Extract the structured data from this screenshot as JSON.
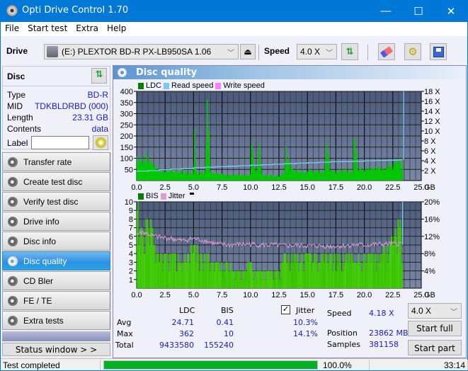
{
  "window": {
    "title": "Opti Drive Control 1.70",
    "controls": {
      "minimize": "—",
      "maximize": "☐",
      "close": "✕"
    }
  },
  "menu": {
    "items": [
      "File",
      "Start test",
      "Extra",
      "Help"
    ]
  },
  "toolbar": {
    "drive_label": "Drive",
    "drive_value": "(E:)  PLEXTOR BD-R  PX-LB950SA 1.06",
    "speed_label": "Speed",
    "speed_value": "4.0 X",
    "icons": [
      "drive-icon",
      "eject-icon",
      "refresh-icon",
      "eraser-icon",
      "settings-icon",
      "save-icon"
    ]
  },
  "disc": {
    "header": "Disc",
    "rows": [
      {
        "key": "Type",
        "value": "BD-R"
      },
      {
        "key": "MID",
        "value": "TDKBLDRBD (000)"
      },
      {
        "key": "Length",
        "value": "23.31 GB"
      },
      {
        "key": "Contents",
        "value": "data"
      }
    ],
    "label_key": "Label",
    "label_value": ""
  },
  "nav": {
    "items": [
      {
        "label": "Transfer rate",
        "active": false
      },
      {
        "label": "Create test disc",
        "active": false
      },
      {
        "label": "Verify test disc",
        "active": false
      },
      {
        "label": "Drive info",
        "active": false
      },
      {
        "label": "Disc info",
        "active": false
      },
      {
        "label": "Disc quality",
        "active": true
      },
      {
        "label": "CD Bler",
        "active": false
      },
      {
        "label": "FE / TE",
        "active": false
      },
      {
        "label": "Extra tests",
        "active": false
      }
    ],
    "status_window_button": "Status window > >"
  },
  "panel": {
    "title": "Disc quality"
  },
  "colors": {
    "ldc": "#00c800",
    "read_speed": "#78c8f0",
    "write_speed": "#ff80ff",
    "bis": "#40c800",
    "jitter": "#d8a0d0",
    "plot_bg_top": "#4a5a7a",
    "plot_bg_bottom": "#7a88a8",
    "active_nav": "#2e8fe0",
    "progress": "#06b025",
    "value_blue": "#1a1acc"
  },
  "chart_data": [
    {
      "type": "area",
      "title": "LDC / Read speed",
      "legend": [
        "LDC",
        "Read speed",
        "Write speed"
      ],
      "legend_placement": "top-left",
      "xlabel": "GB",
      "x_ticks": [
        "0.0",
        "2.5",
        "5.0",
        "7.5",
        "10.0",
        "12.5",
        "15.0",
        "17.5",
        "20.0",
        "22.5",
        "25.0"
      ],
      "xlim": [
        0,
        25
      ],
      "y_left_ticks": [
        "50",
        "100",
        "150",
        "200",
        "250",
        "300",
        "350",
        "400"
      ],
      "ylim_left": [
        0,
        400
      ],
      "y_right_ticks": [
        "2 X",
        "4 X",
        "6 X",
        "8 X",
        "10 X",
        "12 X",
        "14 X",
        "16 X",
        "18 X"
      ],
      "ylim_right": [
        0,
        18
      ],
      "grid": true,
      "series": [
        {
          "name": "LDC",
          "x": [
            0.0,
            0.3,
            0.6,
            0.9,
            1.2,
            1.5,
            1.8,
            2.0,
            2.5,
            3.0,
            3.5,
            4.0,
            4.5,
            5.0,
            5.1,
            5.3,
            5.6,
            6.0,
            6.2,
            6.5,
            7.0,
            7.5,
            8.0,
            9.0,
            10.0,
            10.1,
            10.5,
            10.8,
            11.0,
            12.0,
            12.4,
            12.5,
            13.0,
            13.1,
            13.5,
            14.0,
            15.0,
            15.5,
            16.0,
            16.5,
            16.7,
            17.0,
            17.5,
            18.0,
            18.5,
            19.0,
            19.1,
            19.5,
            20.0,
            20.5,
            21.0,
            21.3,
            21.5,
            22.0,
            22.5,
            22.8,
            23.0,
            23.3,
            23.4
          ],
          "values": [
            120,
            100,
            105,
            110,
            95,
            85,
            60,
            50,
            45,
            45,
            45,
            42,
            40,
            45,
            230,
            40,
            38,
            40,
            362,
            35,
            30,
            30,
            28,
            30,
            30,
            165,
            30,
            160,
            28,
            25,
            25,
            22,
            50,
            155,
            55,
            50,
            50,
            45,
            50,
            45,
            170,
            45,
            45,
            50,
            55,
            50,
            190,
            50,
            55,
            55,
            50,
            90,
            65,
            70,
            75,
            90,
            85,
            60,
            90
          ]
        },
        {
          "name": "Read speed",
          "unit": "X",
          "x": [
            0.0,
            1.0,
            2.0,
            3.0,
            4.0,
            5.0,
            6.0,
            7.0,
            8.0,
            9.0,
            10.0,
            11.0,
            12.0,
            13.0,
            14.0,
            15.0,
            16.0,
            17.0,
            18.0,
            19.0,
            20.0,
            21.0,
            22.0,
            23.0,
            23.3
          ],
          "values": [
            1.9,
            2.0,
            2.2,
            2.3,
            2.4,
            2.6,
            2.7,
            2.8,
            2.9,
            3.0,
            3.1,
            3.2,
            3.3,
            3.4,
            3.5,
            3.6,
            3.7,
            3.8,
            3.85,
            3.9,
            4.0,
            4.05,
            4.1,
            4.15,
            4.18
          ]
        },
        {
          "name": "Write speed",
          "unit": "X",
          "x": [],
          "values": []
        }
      ]
    },
    {
      "type": "area",
      "title": "BIS / Jitter",
      "legend": [
        "BIS",
        "Jitter"
      ],
      "legend_placement": "top-left",
      "xlabel": "GB",
      "x_ticks": [
        "0.0",
        "2.5",
        "5.0",
        "7.5",
        "10.0",
        "12.5",
        "15.0",
        "17.5",
        "20.0",
        "22.5",
        "25.0"
      ],
      "xlim": [
        0,
        25
      ],
      "y_left_ticks": [
        "1",
        "2",
        "3",
        "4",
        "5",
        "6",
        "7",
        "8",
        "9",
        "10"
      ],
      "ylim_left": [
        0,
        10
      ],
      "y_right_ticks": [
        "4%",
        "8%",
        "12%",
        "16%",
        "20%"
      ],
      "ylim_right": [
        0,
        20
      ],
      "grid": true,
      "series": [
        {
          "name": "BIS",
          "x": [
            0.0,
            0.2,
            0.5,
            1.0,
            1.3,
            1.6,
            2.0,
            3.0,
            4.0,
            5.0,
            5.5,
            6.0,
            6.5,
            7.0,
            7.5,
            8.0,
            9.0,
            10.0,
            11.0,
            12.0,
            12.5,
            13.0,
            14.0,
            15.0,
            16.0,
            17.0,
            18.0,
            19.0,
            20.0,
            21.0,
            22.0,
            22.5,
            23.0,
            23.3
          ],
          "values": [
            10,
            8,
            7,
            8,
            7,
            5,
            4,
            4,
            4,
            5,
            4,
            4,
            3,
            3,
            3,
            3,
            2,
            3,
            2,
            2,
            2,
            4,
            4,
            4,
            4,
            4,
            4,
            4,
            4,
            4,
            5,
            7,
            8,
            5
          ]
        },
        {
          "name": "Jitter",
          "unit": "%",
          "x": [
            0.0,
            0.5,
            1.0,
            1.5,
            2.0,
            3.0,
            4.0,
            5.0,
            6.0,
            7.0,
            8.0,
            9.0,
            10.0,
            11.0,
            12.0,
            13.0,
            14.0,
            15.0,
            16.0,
            17.0,
            18.0,
            19.0,
            20.0,
            21.0,
            22.0,
            23.0,
            23.3
          ],
          "values": [
            12.5,
            13.0,
            12.5,
            12.0,
            11.8,
            11.5,
            11.0,
            11.5,
            11.0,
            10.2,
            10.0,
            10.1,
            10.2,
            10.0,
            10.0,
            9.8,
            9.9,
            9.8,
            9.8,
            9.7,
            9.8,
            10.0,
            10.0,
            10.1,
            10.2,
            10.3,
            10.3
          ]
        }
      ]
    }
  ],
  "stats": {
    "col_headers": [
      "LDC",
      "BIS"
    ],
    "rows": [
      {
        "label": "Avg",
        "ldc": "24.71",
        "bis": "0.41",
        "jitter": "10.3%"
      },
      {
        "label": "Max",
        "ldc": "362",
        "bis": "10",
        "jitter": "14.1%"
      },
      {
        "label": "Total",
        "ldc": "9433580",
        "bis": "155240"
      }
    ],
    "jitter_label": "Jitter",
    "jitter_checked": true,
    "speed_label": "Speed",
    "speed_value": "4.18 X",
    "position_label": "Position",
    "position_value": "23862 MB",
    "samples_label": "Samples",
    "samples_value": "381158",
    "speed_select": "4.0 X",
    "start_full": "Start full",
    "start_part": "Start part"
  },
  "statusbar": {
    "status": "Test completed",
    "progress_percent": 100,
    "progress_text": "100.0%",
    "elapsed": "33:14"
  }
}
